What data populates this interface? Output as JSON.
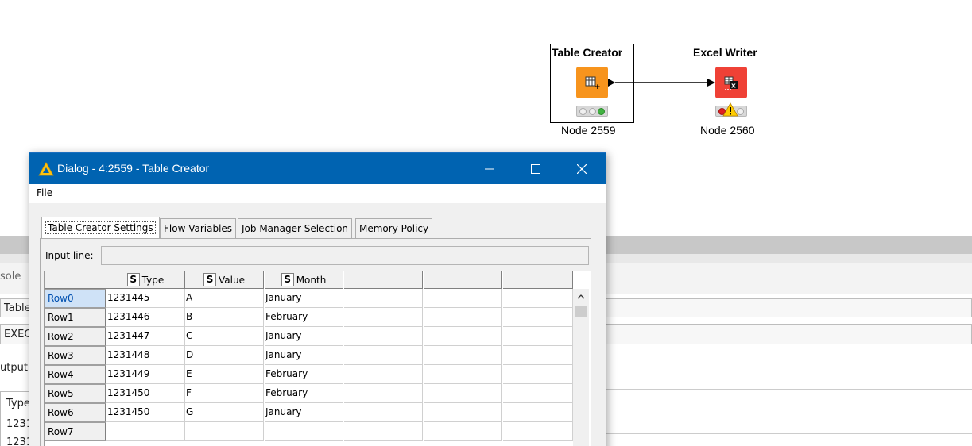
{
  "workflow": {
    "nodes": [
      {
        "title": "Table Creator",
        "label": "Node 2559",
        "status": "executed"
      },
      {
        "title": "Excel Writer",
        "label": "Node 2560",
        "status": "warning"
      }
    ]
  },
  "background": {
    "console_tab": "sole",
    "rows": [
      "Table",
      "EXEC",
      "utput",
      "Type",
      "1231",
      "1231"
    ]
  },
  "dialog": {
    "title": "Dialog - 4:2559 - Table Creator",
    "menu": {
      "file": "File"
    },
    "window_buttons": {
      "minimize": "—",
      "maximize": "☐",
      "close": "✕"
    },
    "tabs": [
      "Table Creator Settings",
      "Flow Variables",
      "Job Manager Selection",
      "Memory Policy"
    ],
    "active_tab": 0,
    "input_line_label": "Input line:",
    "input_line_value": "",
    "table": {
      "column_type_badge": "S",
      "columns": [
        "Type",
        "Value",
        "Month"
      ],
      "rows": [
        {
          "header": "Row0",
          "cells": [
            "1231445",
            "A",
            "January"
          ]
        },
        {
          "header": "Row1",
          "cells": [
            "1231446",
            "B",
            "February"
          ]
        },
        {
          "header": "Row2",
          "cells": [
            "1231447",
            "C",
            "January"
          ]
        },
        {
          "header": "Row3",
          "cells": [
            "1231448",
            "D",
            "January"
          ]
        },
        {
          "header": "Row4",
          "cells": [
            "1231449",
            "E",
            "February"
          ]
        },
        {
          "header": "Row5",
          "cells": [
            "1231450",
            "F",
            "February"
          ]
        },
        {
          "header": "Row6",
          "cells": [
            "1231450",
            "G",
            "January"
          ]
        },
        {
          "header": "Row7",
          "cells": [
            "",
            "",
            ""
          ]
        }
      ]
    }
  },
  "colors": {
    "titlebar": "#0063b1",
    "table_creator_node": "#f7941d",
    "excel_writer_node": "#ef4136",
    "status_green": "#41b341",
    "status_red": "#e02020",
    "warning_yellow": "#ffcc00"
  }
}
